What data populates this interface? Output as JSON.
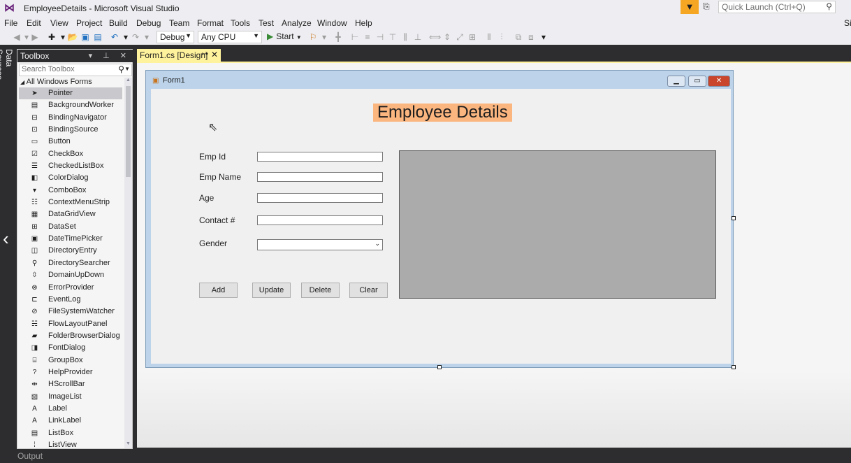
{
  "window": {
    "title": "EmployeeDetails - Microsoft Visual Studio",
    "logo_icon": "visual-studio-logo",
    "quick_launch_placeholder": "Quick Launch (Ctrl+Q)",
    "sign_in": "Sig"
  },
  "menu": [
    "File",
    "Edit",
    "View",
    "Project",
    "Build",
    "Debug",
    "Team",
    "Format",
    "Tools",
    "Test",
    "Analyze",
    "Window",
    "Help"
  ],
  "toolbar": {
    "configuration": "Debug",
    "platform": "Any CPU",
    "start_label": "Start"
  },
  "side_strip": {
    "data_sources_label": "Data Sources"
  },
  "toolbox": {
    "title": "Toolbox",
    "search_placeholder": "Search Toolbox",
    "group_label": "All Windows Forms",
    "items": [
      {
        "label": "Pointer",
        "icon": "pointer-icon"
      },
      {
        "label": "BackgroundWorker",
        "icon": "backgroundworker-icon"
      },
      {
        "label": "BindingNavigator",
        "icon": "bindingnavigator-icon"
      },
      {
        "label": "BindingSource",
        "icon": "bindingsource-icon"
      },
      {
        "label": "Button",
        "icon": "button-icon"
      },
      {
        "label": "CheckBox",
        "icon": "checkbox-icon"
      },
      {
        "label": "CheckedListBox",
        "icon": "checkedlistbox-icon"
      },
      {
        "label": "ColorDialog",
        "icon": "colordialog-icon"
      },
      {
        "label": "ComboBox",
        "icon": "combobox-icon"
      },
      {
        "label": "ContextMenuStrip",
        "icon": "contextmenustrip-icon"
      },
      {
        "label": "DataGridView",
        "icon": "datagridview-icon"
      },
      {
        "label": "DataSet",
        "icon": "dataset-icon"
      },
      {
        "label": "DateTimePicker",
        "icon": "datetimepicker-icon"
      },
      {
        "label": "DirectoryEntry",
        "icon": "directoryentry-icon"
      },
      {
        "label": "DirectorySearcher",
        "icon": "directorysearcher-icon"
      },
      {
        "label": "DomainUpDown",
        "icon": "domainupdown-icon"
      },
      {
        "label": "ErrorProvider",
        "icon": "errorprovider-icon"
      },
      {
        "label": "EventLog",
        "icon": "eventlog-icon"
      },
      {
        "label": "FileSystemWatcher",
        "icon": "filesystemwatcher-icon"
      },
      {
        "label": "FlowLayoutPanel",
        "icon": "flowlayoutpanel-icon"
      },
      {
        "label": "FolderBrowserDialog",
        "icon": "folderbrowserdialog-icon"
      },
      {
        "label": "FontDialog",
        "icon": "fontdialog-icon"
      },
      {
        "label": "GroupBox",
        "icon": "groupbox-icon"
      },
      {
        "label": "HelpProvider",
        "icon": "helpprovider-icon"
      },
      {
        "label": "HScrollBar",
        "icon": "hscrollbar-icon"
      },
      {
        "label": "ImageList",
        "icon": "imagelist-icon"
      },
      {
        "label": "Label",
        "icon": "label-icon"
      },
      {
        "label": "LinkLabel",
        "icon": "linklabel-icon"
      },
      {
        "label": "ListBox",
        "icon": "listbox-icon"
      },
      {
        "label": "ListView",
        "icon": "listview-icon"
      }
    ]
  },
  "document_tab": {
    "label": "Form1.cs [Design]"
  },
  "form": {
    "title": "Form1",
    "heading": "Employee Details",
    "fields": [
      {
        "label": "Emp Id",
        "value": ""
      },
      {
        "label": "Emp Name",
        "value": ""
      },
      {
        "label": "Age",
        "value": ""
      },
      {
        "label": "Contact #",
        "value": ""
      }
    ],
    "gender_label": "Gender",
    "gender_value": "",
    "buttons": [
      "Add",
      "Update",
      "Delete",
      "Clear"
    ]
  },
  "output_tab": "Output",
  "colors": {
    "heading_bg": "#fbb680",
    "doc_tab_bg": "#fff29d",
    "grid_bg": "#ababab",
    "notification_bg": "#f5a623"
  }
}
